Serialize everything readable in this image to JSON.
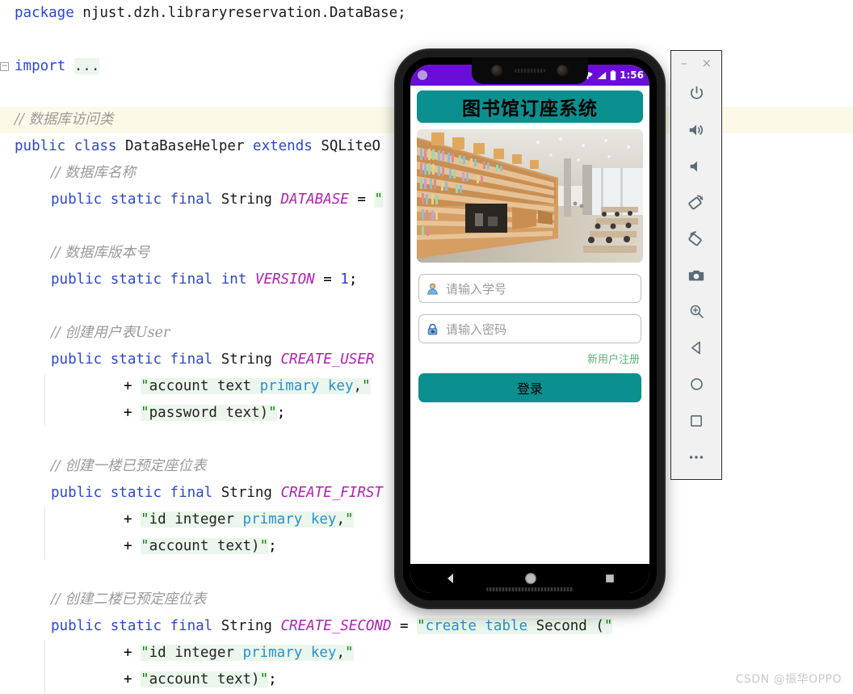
{
  "editor": {
    "language": "java",
    "lines": [
      {
        "indent": 0,
        "segments": [
          {
            "t": "package",
            "c": "kw"
          },
          {
            "t": " njust.dzh.libraryreservation.DataBase;",
            "c": "type"
          }
        ]
      },
      {
        "indent": 0,
        "segments": []
      },
      {
        "indent": 0,
        "fold": true,
        "segments": [
          {
            "t": "import",
            "c": "kw"
          },
          {
            "t": " ",
            "c": "type"
          },
          {
            "t": "...",
            "c": "fold-chip"
          }
        ]
      },
      {
        "indent": 0,
        "segments": []
      },
      {
        "indent": 0,
        "highlight": true,
        "segments": [
          {
            "t": "// 数据库访问类",
            "c": "cmt"
          }
        ]
      },
      {
        "indent": 0,
        "segments": [
          {
            "t": "public",
            "c": "kw"
          },
          {
            "t": " ",
            "c": "type"
          },
          {
            "t": "class",
            "c": "kw"
          },
          {
            "t": " DataBaseHelper ",
            "c": "type"
          },
          {
            "t": "extends",
            "c": "kw"
          },
          {
            "t": " SQLiteO",
            "c": "type"
          }
        ]
      },
      {
        "indent": 1,
        "segments": [
          {
            "t": "// 数据库名称",
            "c": "cmt"
          }
        ]
      },
      {
        "indent": 1,
        "segments": [
          {
            "t": "public",
            "c": "kw"
          },
          {
            "t": " ",
            "c": "type"
          },
          {
            "t": "static",
            "c": "kw"
          },
          {
            "t": " ",
            "c": "type"
          },
          {
            "t": "final",
            "c": "kw"
          },
          {
            "t": " String ",
            "c": "type"
          },
          {
            "t": "DATABASE",
            "c": "field"
          },
          {
            "t": " = ",
            "c": "punc"
          },
          {
            "t": "\"",
            "c": "str"
          }
        ]
      },
      {
        "indent": 1,
        "segments": []
      },
      {
        "indent": 1,
        "segments": [
          {
            "t": "// 数据库版本号",
            "c": "cmt"
          }
        ]
      },
      {
        "indent": 1,
        "segments": [
          {
            "t": "public",
            "c": "kw"
          },
          {
            "t": " ",
            "c": "type"
          },
          {
            "t": "static",
            "c": "kw"
          },
          {
            "t": " ",
            "c": "type"
          },
          {
            "t": "final",
            "c": "kw"
          },
          {
            "t": " ",
            "c": "type"
          },
          {
            "t": "int",
            "c": "kw"
          },
          {
            "t": " ",
            "c": "type"
          },
          {
            "t": "VERSION",
            "c": "field"
          },
          {
            "t": " = ",
            "c": "punc"
          },
          {
            "t": "1",
            "c": "num"
          },
          {
            "t": ";",
            "c": "punc"
          }
        ]
      },
      {
        "indent": 1,
        "segments": []
      },
      {
        "indent": 1,
        "segments": [
          {
            "t": "// 创建用户表User",
            "c": "cmt"
          }
        ]
      },
      {
        "indent": 1,
        "segments": [
          {
            "t": "public",
            "c": "kw"
          },
          {
            "t": " ",
            "c": "type"
          },
          {
            "t": "static",
            "c": "kw"
          },
          {
            "t": " ",
            "c": "type"
          },
          {
            "t": "final",
            "c": "kw"
          },
          {
            "t": " String ",
            "c": "type"
          },
          {
            "t": "CREATE_USER",
            "c": "field"
          }
        ]
      },
      {
        "indent": 3,
        "guide": true,
        "segments": [
          {
            "t": "+ ",
            "c": "punc"
          },
          {
            "t": "\"",
            "c": "str"
          },
          {
            "t": "account text ",
            "c": "strbody"
          },
          {
            "t": "primary key",
            "c": "sqlkw"
          },
          {
            "t": ",",
            "c": "strbody"
          },
          {
            "t": "\"",
            "c": "str"
          }
        ]
      },
      {
        "indent": 3,
        "guide": true,
        "segments": [
          {
            "t": "+ ",
            "c": "punc"
          },
          {
            "t": "\"",
            "c": "str"
          },
          {
            "t": "password text)",
            "c": "strbody"
          },
          {
            "t": "\"",
            "c": "str"
          },
          {
            "t": ";",
            "c": "punc"
          }
        ]
      },
      {
        "indent": 1,
        "segments": []
      },
      {
        "indent": 1,
        "segments": [
          {
            "t": "// 创建一楼已预定座位表",
            "c": "cmt"
          }
        ]
      },
      {
        "indent": 1,
        "segments": [
          {
            "t": "public",
            "c": "kw"
          },
          {
            "t": " ",
            "c": "type"
          },
          {
            "t": "static",
            "c": "kw"
          },
          {
            "t": " ",
            "c": "type"
          },
          {
            "t": "final",
            "c": "kw"
          },
          {
            "t": " String ",
            "c": "type"
          },
          {
            "t": "CREATE_FIRST",
            "c": "field"
          }
        ]
      },
      {
        "indent": 3,
        "guide": true,
        "segments": [
          {
            "t": "+ ",
            "c": "punc"
          },
          {
            "t": "\"",
            "c": "str"
          },
          {
            "t": "id integer ",
            "c": "strbody"
          },
          {
            "t": "primary key",
            "c": "sqlkw"
          },
          {
            "t": ",",
            "c": "strbody"
          },
          {
            "t": "\"",
            "c": "str"
          }
        ]
      },
      {
        "indent": 3,
        "guide": true,
        "segments": [
          {
            "t": "+ ",
            "c": "punc"
          },
          {
            "t": "\"",
            "c": "str"
          },
          {
            "t": "account text)",
            "c": "strbody"
          },
          {
            "t": "\"",
            "c": "str"
          },
          {
            "t": ";",
            "c": "punc"
          }
        ]
      },
      {
        "indent": 1,
        "segments": []
      },
      {
        "indent": 1,
        "segments": [
          {
            "t": "// 创建二楼已预定座位表",
            "c": "cmt"
          }
        ]
      },
      {
        "indent": 1,
        "segments": [
          {
            "t": "public",
            "c": "kw"
          },
          {
            "t": " ",
            "c": "type"
          },
          {
            "t": "static",
            "c": "kw"
          },
          {
            "t": " ",
            "c": "type"
          },
          {
            "t": "final",
            "c": "kw"
          },
          {
            "t": " String ",
            "c": "type"
          },
          {
            "t": "CREATE_SECOND",
            "c": "field"
          },
          {
            "t": " = ",
            "c": "punc"
          },
          {
            "t": "\"",
            "c": "str"
          },
          {
            "t": "create table",
            "c": "sqlkw"
          },
          {
            "t": " Second (",
            "c": "strbody"
          },
          {
            "t": "\"",
            "c": "str"
          }
        ]
      },
      {
        "indent": 3,
        "guide": true,
        "segments": [
          {
            "t": "+ ",
            "c": "punc"
          },
          {
            "t": "\"",
            "c": "str"
          },
          {
            "t": "id integer ",
            "c": "strbody"
          },
          {
            "t": "primary key",
            "c": "sqlkw"
          },
          {
            "t": ",",
            "c": "strbody"
          },
          {
            "t": "\"",
            "c": "str"
          }
        ]
      },
      {
        "indent": 3,
        "guide": true,
        "segments": [
          {
            "t": "+ ",
            "c": "punc"
          },
          {
            "t": "\"",
            "c": "str"
          },
          {
            "t": "account text)",
            "c": "strbody"
          },
          {
            "t": "\"",
            "c": "str"
          },
          {
            "t": ";",
            "c": "punc"
          }
        ]
      }
    ]
  },
  "phone": {
    "statusbar": {
      "time": "1:56",
      "wifi_icon": "wifi-off-icon",
      "signal_icon": "signal-icon",
      "battery_icon": "battery-icon"
    },
    "app": {
      "title": "图书馆订座系统",
      "hero_alt": "library-interior-photo",
      "fields": [
        {
          "name": "student-id",
          "icon": "user-icon",
          "placeholder": "请输入学号",
          "value": ""
        },
        {
          "name": "password",
          "icon": "lock-icon",
          "placeholder": "请输入密码",
          "value": ""
        }
      ],
      "register_link": "新用户注册",
      "login_button": "登录",
      "accent_color": "#0b8f8f",
      "link_color": "#5cb377"
    },
    "navbar": [
      {
        "name": "back",
        "icon": "back-triangle-icon"
      },
      {
        "name": "home",
        "icon": "home-circle-icon"
      },
      {
        "name": "recents",
        "icon": "recents-square-icon"
      }
    ]
  },
  "toolbar": {
    "window": {
      "minimize": "–",
      "close": "×"
    },
    "buttons": [
      {
        "name": "power",
        "icon": "power-icon",
        "label": "Power"
      },
      {
        "name": "volume-up",
        "icon": "volume-up-icon",
        "label": "Volume Up"
      },
      {
        "name": "volume-down",
        "icon": "volume-down-icon",
        "label": "Volume Down"
      },
      {
        "name": "rotate-left",
        "icon": "rotate-left-icon",
        "label": "Rotate Left"
      },
      {
        "name": "rotate-right",
        "icon": "rotate-right-icon",
        "label": "Rotate Right"
      },
      {
        "name": "screenshot",
        "icon": "camera-icon",
        "label": "Take Screenshot"
      },
      {
        "name": "zoom",
        "icon": "zoom-in-icon",
        "label": "Zoom Mode"
      },
      {
        "name": "nav-back",
        "icon": "back-triangle-icon",
        "label": "Back"
      },
      {
        "name": "nav-home",
        "icon": "home-circle-icon",
        "label": "Home"
      },
      {
        "name": "nav-overview",
        "icon": "overview-square-icon",
        "label": "Overview"
      },
      {
        "name": "more",
        "icon": "more-dots-icon",
        "label": "More"
      }
    ]
  },
  "watermark": "CSDN @振华OPPO"
}
